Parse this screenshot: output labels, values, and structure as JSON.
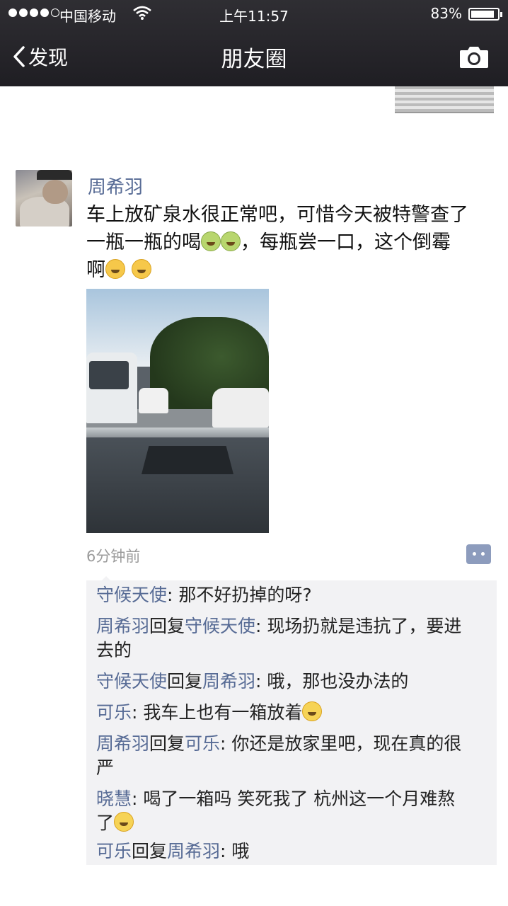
{
  "status_bar": {
    "carrier": "中国移动",
    "time": "上午11:57",
    "battery": "83%"
  },
  "nav": {
    "back_label": "发现",
    "title": "朋友圈"
  },
  "post": {
    "author": "周希羽",
    "text_line1": "车上放矿泉水很正常吧，可惜今天被特警查了",
    "text_line2a": "一瓶一瓶的喝",
    "text_line2b": "，每瓶尝一口，这个倒霉",
    "text_line3": "啊",
    "time_ago": "6分钟前"
  },
  "comments": [
    {
      "name": "守候天使",
      "reply_word": "",
      "reply_to": "",
      "text": ": 那不好扔掉的呀?"
    },
    {
      "name": "周希羽",
      "reply_word": "回复",
      "reply_to": "守候天使",
      "text": ": 现场扔就是违抗了，要进",
      "text2": "去的"
    },
    {
      "name": "守候天使",
      "reply_word": "回复",
      "reply_to": "周希羽",
      "text": ": 哦，那也没办法的"
    },
    {
      "name": "可乐",
      "reply_word": "",
      "reply_to": "",
      "text": ": 我车上也有一箱放着"
    },
    {
      "name": "周希羽",
      "reply_word": "回复",
      "reply_to": "可乐",
      "text": ": 你还是放家里吧，现在真的很",
      "text2": "严"
    },
    {
      "name": "晓慧",
      "reply_word": "",
      "reply_to": "",
      "text": ": 喝了一箱吗 笑死我了 杭州这一个月难熬",
      "text2": "了"
    },
    {
      "name": "可乐",
      "reply_word": "回复",
      "reply_to": "周希羽",
      "text": ": 哦"
    }
  ],
  "colors": {
    "link": "#576b95",
    "nav_bg": "#2a292e",
    "comment_bg": "#f2f2f4"
  }
}
